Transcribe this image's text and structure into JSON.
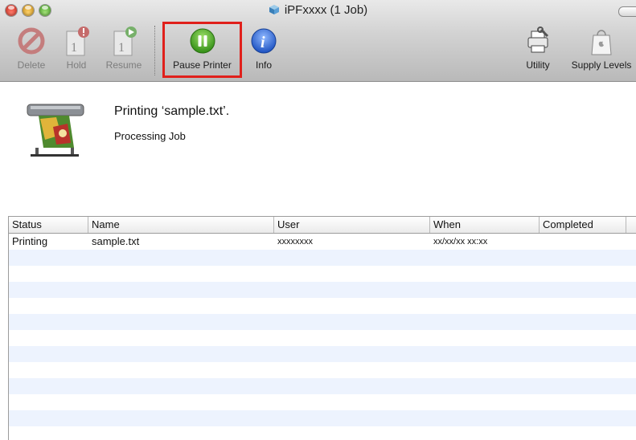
{
  "window": {
    "title": "iPFxxxx (1 Job)"
  },
  "toolbar": {
    "buttons": [
      {
        "label": "Delete",
        "icon": "delete-icon",
        "enabled": false
      },
      {
        "label": "Hold",
        "icon": "hold-icon",
        "enabled": false
      },
      {
        "label": "Resume",
        "icon": "resume-icon",
        "enabled": false
      },
      {
        "label": "Pause Printer",
        "icon": "pause-icon",
        "enabled": true
      },
      {
        "label": "Info",
        "icon": "info-icon",
        "enabled": true
      },
      {
        "label": "Utility",
        "icon": "utility-icon",
        "enabled": true
      },
      {
        "label": "Supply Levels",
        "icon": "supply-levels-icon",
        "enabled": true
      }
    ]
  },
  "status": {
    "main": "Printing ‘sample.txt’.",
    "sub": "Processing Job"
  },
  "table": {
    "columns": [
      "Status",
      "Name",
      "User",
      "When",
      "Completed"
    ],
    "rows": [
      {
        "status": "Printing",
        "name": "sample.txt",
        "user": "xxxxxxxx",
        "when": "xx/xx/xx xx:xx",
        "completed": ""
      }
    ]
  },
  "colors": {
    "highlight": "#e0201b",
    "pause_green": "#3aa51f",
    "info_blue": "#2a64d6",
    "row_stripe": "#edf3fe"
  }
}
